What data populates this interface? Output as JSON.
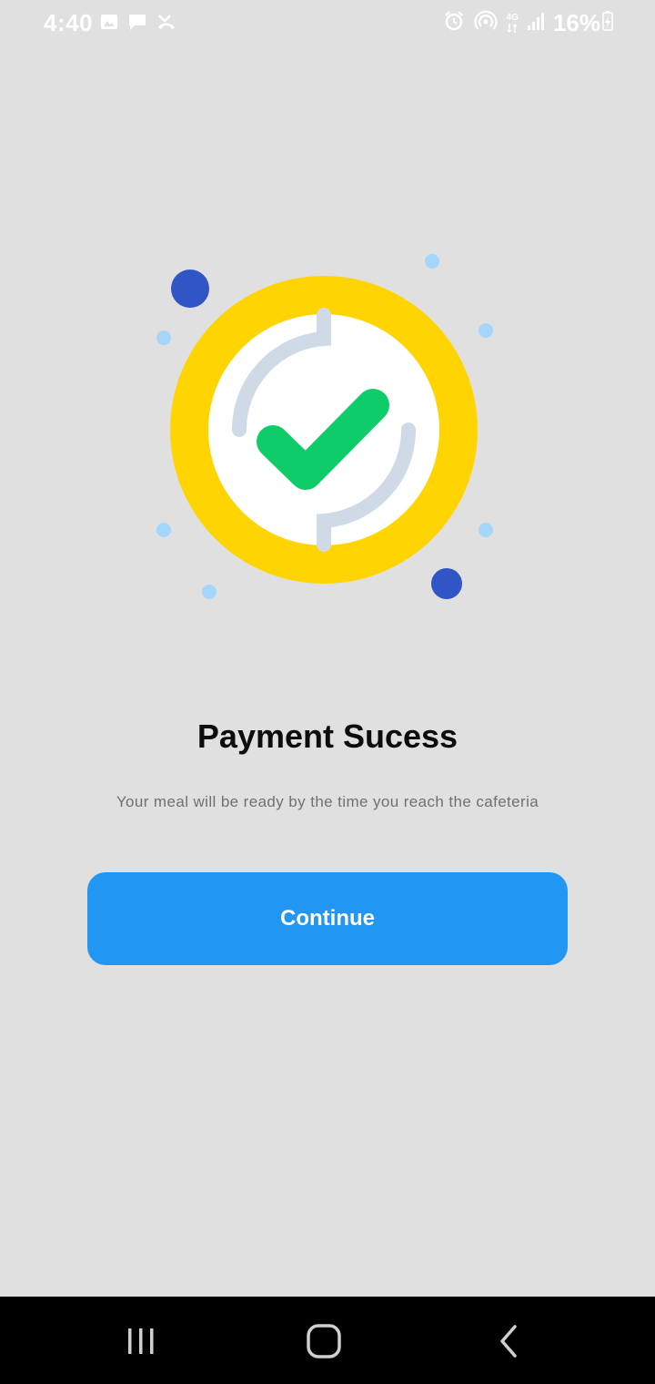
{
  "status_bar": {
    "time": "4:40",
    "battery": "16%",
    "network_top": "4G",
    "left_icons": [
      "gallery-icon",
      "message-icon",
      "missed-call-icon"
    ],
    "right_icons": [
      "alarm-icon",
      "hotspot-icon",
      "network-4g-icon",
      "signal-icon",
      "battery-charging-icon"
    ]
  },
  "illustration": {
    "icon": "payment-success-check-icon",
    "colors": {
      "ring": "#ffd400",
      "inner": "#ffffff",
      "arc": "#d0dae6",
      "check": "#0ecd69",
      "dot_dark": "#3154c7",
      "dot_light": "#a4d5fb"
    }
  },
  "main": {
    "title": "Payment Sucess",
    "subtitle": "Your meal will be ready by the time you reach the cafeteria",
    "continue_label": "Continue"
  },
  "colors": {
    "background": "#e0e0e0",
    "accent": "#2196f3"
  },
  "nav_bar": {
    "icons": [
      "recent-apps-icon",
      "home-icon",
      "back-icon"
    ]
  }
}
